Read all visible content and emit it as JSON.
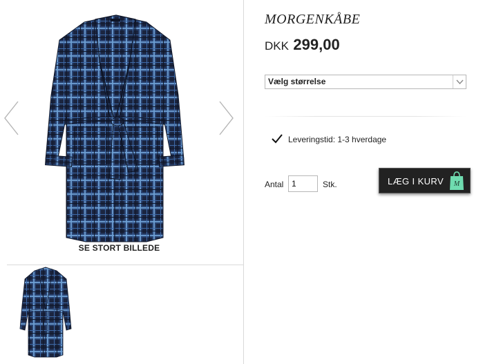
{
  "gallery": {
    "main_image": "robe-front",
    "zoom_label": "SE STORT BILLEDE",
    "prev_icon": "chevron-left-icon",
    "next_icon": "chevron-right-icon",
    "thumbnails": [
      "robe-front"
    ]
  },
  "product": {
    "title": "MORGENKÅBE",
    "currency": "DKK",
    "price": "299,00"
  },
  "size_select": {
    "selected": "Vælg størrelse",
    "icon": "chevron-down-icon"
  },
  "delivery": {
    "icon": "checkmark-icon",
    "text": "Leveringstid: 1-3 hverdage"
  },
  "quantity": {
    "label": "Antal",
    "value": "1",
    "unit": "Stk."
  },
  "cart_button": {
    "label": "LÆG I KURV",
    "icon": "shopping-bag-icon",
    "icon_text": "M",
    "icon_color": "#6fdcb0"
  },
  "colors": {
    "robe_dark": "#1b2540",
    "robe_check": "#3e6aa8",
    "robe_light": "#6ea0d4",
    "button_bg": "#222222",
    "divider": "#d9d9d9"
  }
}
